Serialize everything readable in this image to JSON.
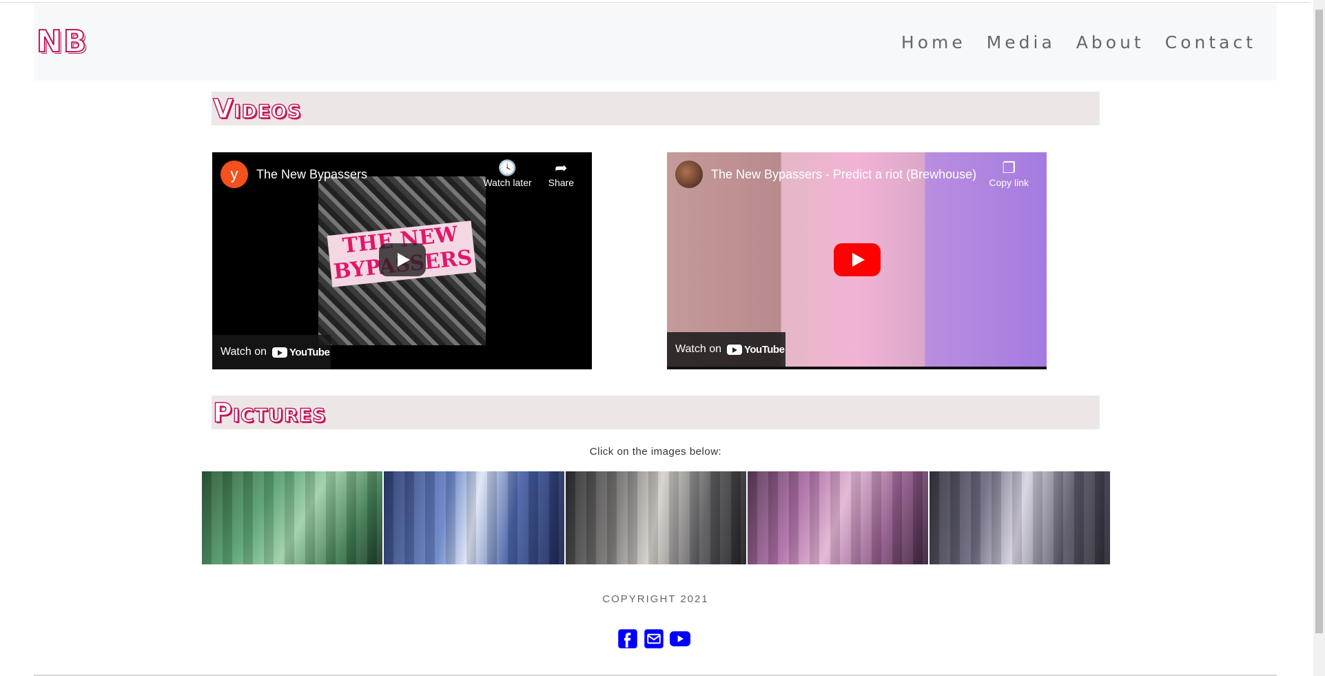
{
  "navbar": {
    "brand": "NB",
    "links": [
      "Home",
      "Media",
      "About",
      "Contact"
    ]
  },
  "videos_section": {
    "heading": "Videos"
  },
  "videos": [
    {
      "channel_avatar": "y",
      "title": "The New Bypassers",
      "poster_text": "THE NEW BYPASSERS",
      "actions": [
        {
          "icon": "clock-icon",
          "label": "Watch later"
        },
        {
          "icon": "share-icon",
          "label": "Share"
        }
      ],
      "watch_on": "Watch on",
      "youtube_logo": "YouTube"
    },
    {
      "title": "The New Bypassers - Predict a riot (Brewhouse)",
      "actions": [
        {
          "icon": "copy-icon",
          "label": "Copy link"
        }
      ],
      "watch_on": "Watch on",
      "youtube_logo": "YouTube"
    }
  ],
  "pictures_section": {
    "heading": "Pictures",
    "instructions": "Click on the images below:"
  },
  "footer": {
    "copyright": "COPYRIGHT 2021",
    "social_icons": [
      "facebook-icon",
      "email-icon",
      "youtube-icon"
    ],
    "social_color": "#0000ff"
  },
  "colors": {
    "brand_accent": "#c2185b",
    "navbar_bg": "#f7f8fa",
    "section_bg": "#ede6e6"
  }
}
